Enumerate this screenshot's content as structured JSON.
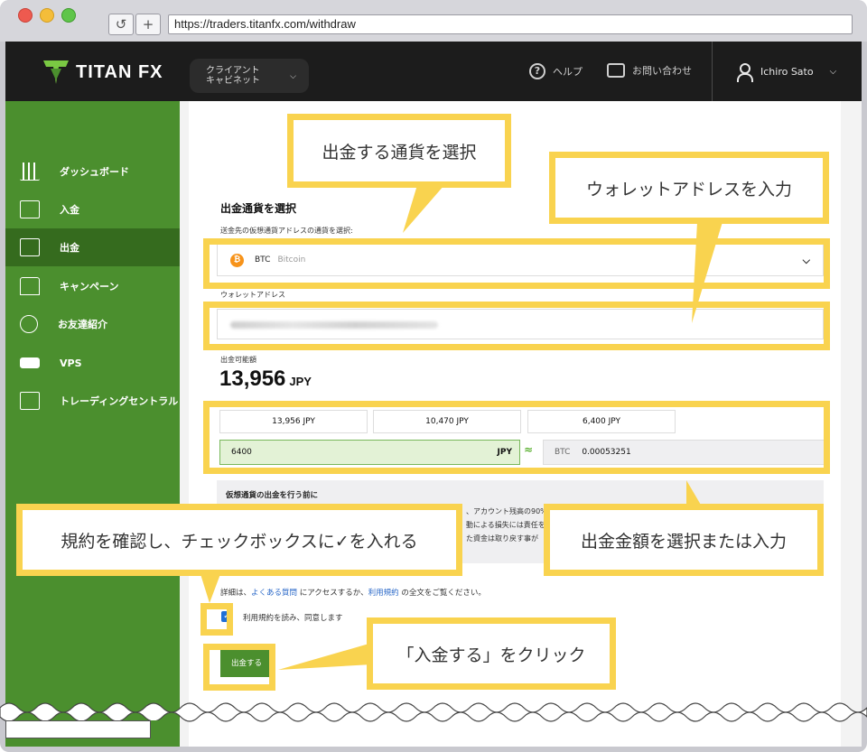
{
  "browser": {
    "url": "https://traders.titanfx.com/withdraw",
    "reload_icon": "↺",
    "new_tab_icon": "+"
  },
  "header": {
    "logo_text": "TITAN FX",
    "cabinet_line1": "クライアント",
    "cabinet_line2": "キャビネット",
    "help_label": "ヘルプ",
    "help_icon_glyph": "?",
    "contact_label": "お問い合わせ",
    "user_name": "Ichiro Sato",
    "chevron": "⌵"
  },
  "sidebar": {
    "items": [
      {
        "label": "ダッシュボード",
        "icon": "bar-chart-icon"
      },
      {
        "label": "入金",
        "icon": "deposit-icon"
      },
      {
        "label": "出金",
        "icon": "withdraw-icon"
      },
      {
        "label": "キャンペーン",
        "icon": "star-badge-icon"
      },
      {
        "label": "お友達紹介",
        "icon": "people-icon"
      },
      {
        "label": "VPS",
        "icon": "server-icon"
      },
      {
        "label": "トレーディングセントラル",
        "icon": "monitor-chart-icon"
      }
    ]
  },
  "form": {
    "section_title": "出金通貨を選択",
    "currency_label": "送金先の仮想通貨アドレスの通貨を選択:",
    "currency_symbol": "₿",
    "currency_code": "BTC",
    "currency_name": "Bitcoin",
    "wallet_label": "ウォレットアドレス",
    "available_label": "出金可能額",
    "available_amount": "13,956",
    "available_unit": "JPY",
    "amount_buttons": [
      "13,956 JPY",
      "10,470 JPY",
      "6,400 JPY"
    ],
    "amount_input": "6400",
    "amount_currency": "JPY",
    "approx_symbol": "≈",
    "btc_label": "BTC",
    "btc_value": "0.00053251",
    "notice_title": "仮想通貨の出金を行う前に",
    "notice_line1": "、アカウント残高の90%",
    "notice_line2": "動による損失には責任を",
    "notice_line3": "た資金は取り戻す事が",
    "detail_prefix": "詳細は、",
    "detail_link1": "よくある質問",
    "detail_mid": " にアクセスするか、",
    "detail_link2": "利用規約",
    "detail_suffix": " の全文をご覧ください。",
    "check_glyph": "✓",
    "checkbox_label": "利用規約を読み、同意します",
    "submit_label": "出金する"
  },
  "callouts": {
    "select_currency": "出金する通貨を選択",
    "wallet_address": "ウォレットアドレスを入力",
    "amount": "出金金額を選択または入力",
    "terms": "規約を確認し、チェックボックスに✓を入れる",
    "submit": "「入金する」をクリック"
  },
  "colors": {
    "accent_yellow": "#f9d34f",
    "brand_green": "#4b8f2e",
    "header_dark": "#1c1c1c"
  }
}
